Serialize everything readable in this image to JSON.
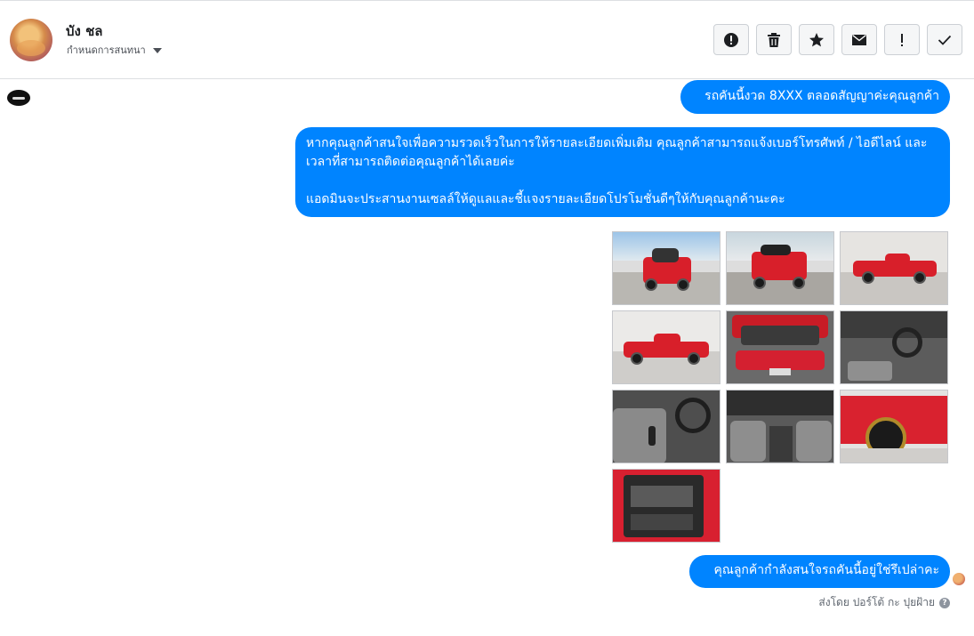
{
  "header": {
    "contact_name": "บัง ชล",
    "assign_label": "กำหนดการสนทนา",
    "actions": [
      "report-icon",
      "trash-icon",
      "star-icon",
      "envelope-icon",
      "exclamation-icon",
      "check-icon"
    ]
  },
  "messages": {
    "m1": "รถคันนี้งวด 8XXX ตลอดสัญญาค่ะคุณลูกค้า",
    "m2": "หากคุณลูกค้าสนใจเพื่อความรวดเร็วในการให้รายละเอียดเพิ่มเติม คุณลูกค้าสามารถแจ้งเบอร์โทรศัพท์ / ไอดีไลน์ และเวลาที่สามารถติดต่อคุณลูกค้าได้เลยค่ะ\n\nแอดมินจะประสานงานเซลล์ให้ดูแลและชี้แจงรายละเอียดโปรโมชั่นดีๆให้กับคุณลูกค้านะคะ",
    "m3": "คุณลูกค้ากำลังสนใจรถคันนี้อยู่ใช่รึเปล่าคะ"
  },
  "attachments": {
    "count": 10,
    "images": [
      "red-pickup-front",
      "red-pickup-rear",
      "red-pickup-side",
      "red-pickup-side-2",
      "engine-bay",
      "dashboard",
      "gear-shift",
      "interior-cabin",
      "front-wheel",
      "door-panel"
    ]
  },
  "footer": {
    "sent_by": "ส่งโดย ปอร์โต้ กะ ปุยฝ้าย",
    "help": "?"
  },
  "colors": {
    "bubble": "#0084ff",
    "bubble_text": "#ffffff",
    "border": "#dddfe2"
  }
}
